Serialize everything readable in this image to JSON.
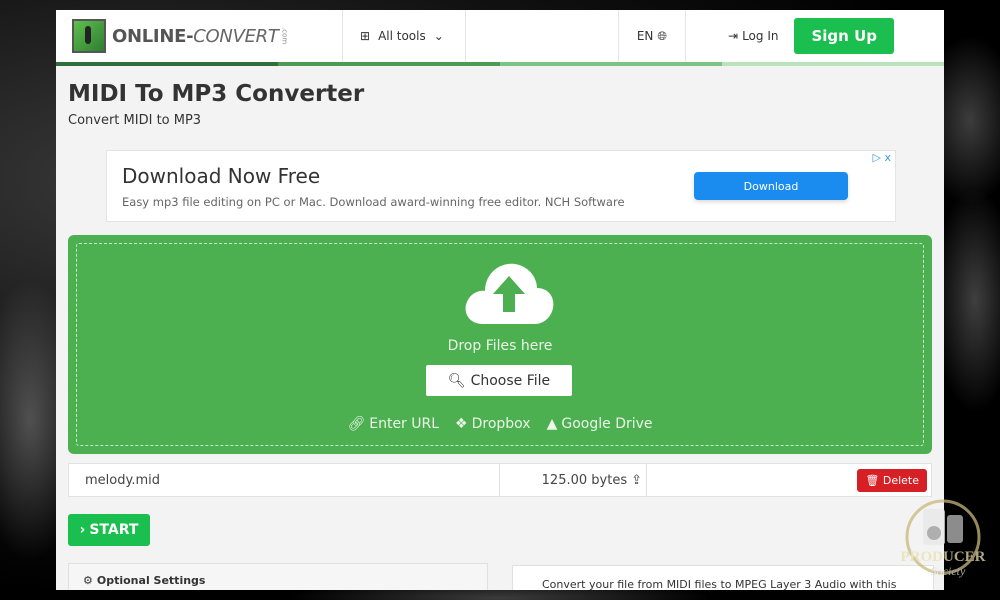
{
  "header": {
    "logo_text": "ONLINE-",
    "logo_text_italic": "CONVERT",
    "logo_suffix": ".com",
    "all_tools_label": "All tools",
    "language_label": "EN",
    "login_label": "Log In",
    "signup_label": "Sign Up"
  },
  "page": {
    "title": "MIDI To MP3 Converter",
    "subtitle": "Convert MIDI to MP3"
  },
  "ad": {
    "title": "Download Now Free",
    "description": "Easy mp3 file editing on PC or Mac. Download award-winning free editor. NCH Software",
    "button_label": "Download",
    "choices_label": "▷ x"
  },
  "upload": {
    "drop_text": "Drop Files here",
    "choose_file_label": "Choose File",
    "sources": [
      {
        "label": "Enter URL",
        "icon": "link-icon"
      },
      {
        "label": "Dropbox",
        "icon": "dropbox-icon"
      },
      {
        "label": "Google Drive",
        "icon": "google-drive-icon"
      }
    ]
  },
  "file": {
    "name": "melody.mid",
    "size": "125.00 bytes",
    "delete_label": "Delete"
  },
  "actions": {
    "start_label": "START"
  },
  "settings": {
    "optional_settings_label": "Optional Settings"
  },
  "description": {
    "text": "Convert your file from MIDI files to MPEG Layer 3 Audio with this"
  },
  "watermark": {
    "text": "PRODUCER Society"
  },
  "colors": {
    "brand_green": "#1bbf4f",
    "dropzone_green": "#4caf50",
    "delete_red": "#d71f26",
    "ad_blue": "#1a8cf0"
  }
}
